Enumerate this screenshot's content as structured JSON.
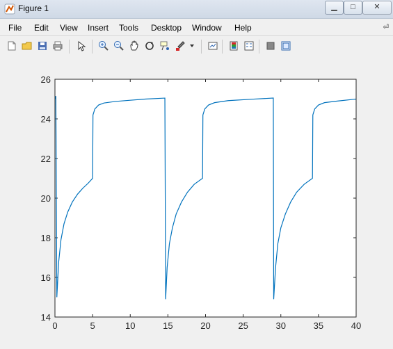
{
  "window": {
    "title": "Figure 1"
  },
  "menu": {
    "items": [
      "File",
      "Edit",
      "View",
      "Insert",
      "Tools",
      "Desktop",
      "Window",
      "Help"
    ],
    "more_arrow": "⏎"
  },
  "chart_data": {
    "type": "line",
    "xlim": [
      0,
      40
    ],
    "ylim": [
      14,
      26
    ],
    "xticks": [
      0,
      5,
      10,
      15,
      20,
      25,
      30,
      35,
      40
    ],
    "yticks": [
      14,
      16,
      18,
      20,
      22,
      24,
      26
    ],
    "xtick_labels": [
      "0",
      "5",
      "10",
      "15",
      "20",
      "25",
      "30",
      "35",
      "40"
    ],
    "ytick_labels": [
      "14",
      "16",
      "18",
      "20",
      "22",
      "24",
      "26"
    ],
    "title": "",
    "xlabel": "",
    "ylabel": "",
    "grid": false,
    "line_color": "#0072bd",
    "series": [
      {
        "values": [
          [
            0.0,
            25.0
          ],
          [
            0.12,
            25.15
          ],
          [
            0.25,
            15.0
          ],
          [
            0.5,
            16.8
          ],
          [
            0.8,
            17.9
          ],
          [
            1.2,
            18.7
          ],
          [
            1.7,
            19.3
          ],
          [
            2.3,
            19.8
          ],
          [
            3.0,
            20.2
          ],
          [
            3.7,
            20.5
          ],
          [
            4.4,
            20.75
          ],
          [
            5.0,
            21.0
          ],
          [
            5.05,
            24.2
          ],
          [
            5.3,
            24.5
          ],
          [
            5.8,
            24.7
          ],
          [
            6.5,
            24.8
          ],
          [
            8.0,
            24.88
          ],
          [
            10.0,
            24.94
          ],
          [
            12.0,
            25.0
          ],
          [
            14.6,
            25.05
          ],
          [
            14.7,
            14.9
          ],
          [
            14.9,
            16.5
          ],
          [
            15.2,
            17.7
          ],
          [
            15.6,
            18.5
          ],
          [
            16.1,
            19.2
          ],
          [
            16.8,
            19.8
          ],
          [
            17.6,
            20.3
          ],
          [
            18.5,
            20.7
          ],
          [
            19.6,
            21.0
          ],
          [
            19.65,
            24.2
          ],
          [
            19.9,
            24.5
          ],
          [
            20.4,
            24.7
          ],
          [
            21.2,
            24.82
          ],
          [
            23.0,
            24.92
          ],
          [
            26.0,
            24.99
          ],
          [
            29.0,
            25.05
          ],
          [
            29.05,
            14.9
          ],
          [
            29.3,
            16.5
          ],
          [
            29.6,
            17.7
          ],
          [
            30.0,
            18.5
          ],
          [
            30.6,
            19.2
          ],
          [
            31.3,
            19.8
          ],
          [
            32.1,
            20.3
          ],
          [
            33.1,
            20.7
          ],
          [
            34.2,
            21.0
          ],
          [
            34.25,
            24.2
          ],
          [
            34.5,
            24.5
          ],
          [
            35.0,
            24.7
          ],
          [
            35.8,
            24.82
          ],
          [
            37.5,
            24.9
          ],
          [
            40.0,
            25.0
          ]
        ]
      }
    ]
  }
}
